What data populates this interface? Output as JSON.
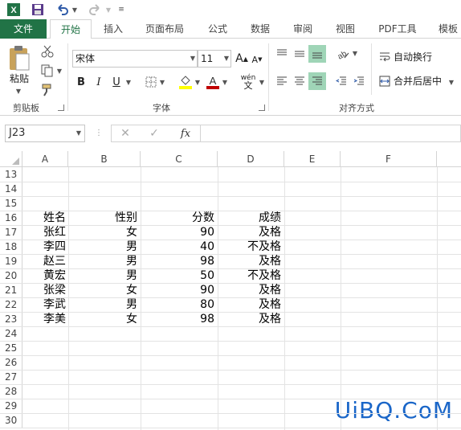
{
  "qat": {
    "icons": [
      "excel-logo-icon",
      "save-icon",
      "undo-icon",
      "redo-icon",
      "customize-icon"
    ]
  },
  "tabs": [
    "文件",
    "开始",
    "插入",
    "页面布局",
    "公式",
    "数据",
    "审阅",
    "视图",
    "PDF工具",
    "模板"
  ],
  "active_tab": "开始",
  "ribbon": {
    "clipboard": {
      "paste": "粘贴",
      "label": "剪贴板"
    },
    "font": {
      "name": "宋体",
      "size": "11",
      "bold": "B",
      "italic": "I",
      "underline": "U",
      "phonetic": "wén",
      "label": "字体"
    },
    "alignment": {
      "wrap": "自动换行",
      "merge": "合并后居中",
      "label": "对齐方式"
    }
  },
  "formula_bar": {
    "name_box": "J23",
    "fx": "fx",
    "value": ""
  },
  "sheet": {
    "columns": [
      "A",
      "B",
      "C",
      "D",
      "E",
      "F"
    ],
    "rows": [
      "13",
      "14",
      "15",
      "16",
      "17",
      "18",
      "19",
      "20",
      "21",
      "22",
      "23",
      "24",
      "25",
      "26",
      "27",
      "28",
      "29",
      "30"
    ],
    "header": [
      "姓名",
      "性别",
      "分数",
      "成绩"
    ],
    "records": [
      [
        "张红",
        "女",
        "90",
        "及格"
      ],
      [
        "李四",
        "男",
        "40",
        "不及格"
      ],
      [
        "赵三",
        "男",
        "98",
        "及格"
      ],
      [
        "黄宏",
        "男",
        "50",
        "不及格"
      ],
      [
        "张梁",
        "女",
        "90",
        "及格"
      ],
      [
        "李武",
        "男",
        "80",
        "及格"
      ],
      [
        "李美",
        "女",
        "98",
        "及格"
      ]
    ]
  },
  "watermark": "UiBQ.CoM",
  "colors": {
    "accent": "#217346",
    "highlight": "#9fd5b7",
    "watermark": "#1a66c8"
  }
}
